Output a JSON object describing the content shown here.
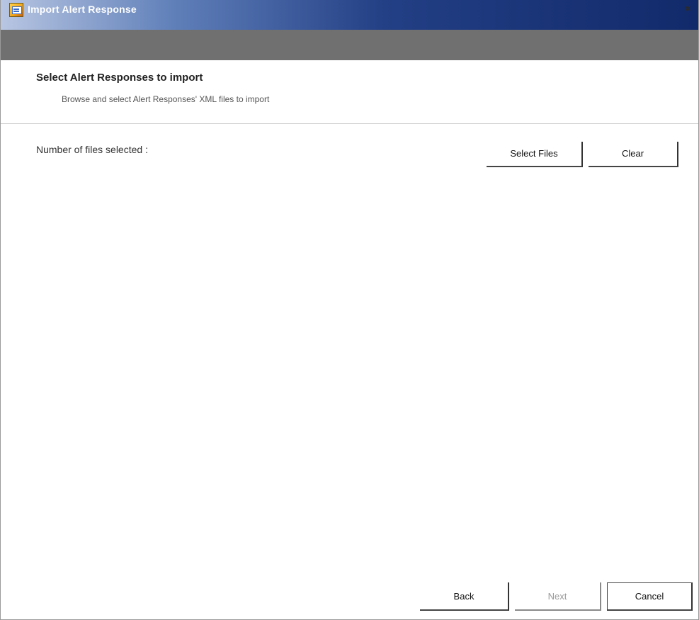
{
  "window": {
    "title": "Import Alert Response",
    "close_glyph": "×",
    "app_icon": "app-icon"
  },
  "header": {
    "title": "Select Alert Responses to import",
    "subtitle": "Browse and select Alert Responses' XML files to import"
  },
  "files": {
    "label": "Number of files selected :",
    "count": ""
  },
  "buttons": {
    "select_files": "Select Files",
    "clear": "Clear",
    "back": "Back",
    "next": "Next",
    "cancel": "Cancel"
  },
  "colors": {
    "titlebar_dark": "#112a6a",
    "toolstrip": "#707070"
  }
}
